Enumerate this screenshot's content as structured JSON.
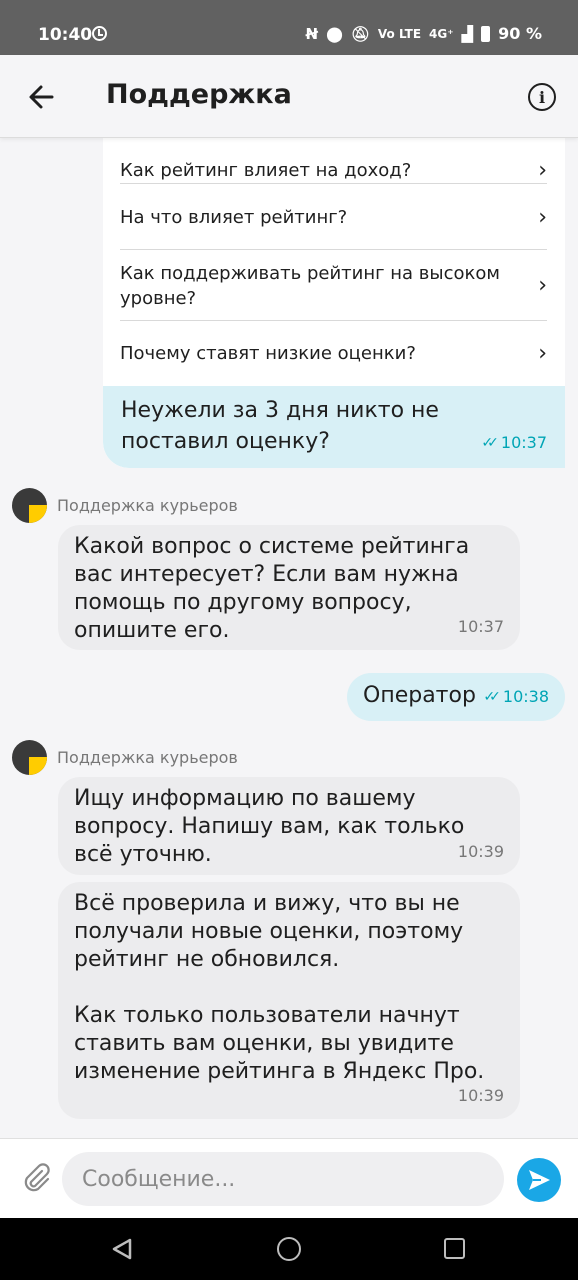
{
  "status_bar": {
    "time": "10:40",
    "network": "4G⁺",
    "volte": "Vo LTE",
    "battery": "90 %",
    "icons": [
      "alarm-clock-icon",
      "nfc-icon",
      "location-icon",
      "mute-icon",
      "volte-icon",
      "signal-icon",
      "battery-icon"
    ]
  },
  "header": {
    "title": "Поддержка",
    "back_icon": "arrow-left-icon",
    "info_icon": "info-icon"
  },
  "faq_card": {
    "items": [
      {
        "label": "Как рейтинг влияет на доход?"
      },
      {
        "label": "На что влияет рейтинг?"
      },
      {
        "label": "Как поддерживать рейтинг на высоком уровне?"
      },
      {
        "label": "Почему ставят низкие оценки?"
      }
    ],
    "chevron_icon": "chevron-right-icon"
  },
  "messages": [
    {
      "type": "out",
      "text": "Неужели за 3 дня никто не поставил оценку?",
      "time": "10:37"
    },
    {
      "type": "in",
      "sender": "Поддержка курьеров",
      "text": "Какой вопрос о системе рейтинга вас интересует? Если вам нужна помощь по другому вопросу, опишите его.",
      "time": "10:37"
    },
    {
      "type": "out",
      "text": "Оператор",
      "time": "10:38"
    },
    {
      "type": "in",
      "sender": "Поддержка курьеров",
      "text": "Ищу информацию по вашему вопросу. Напишу вам, как только всё уточню.",
      "time": "10:39"
    },
    {
      "type": "in",
      "text": "Всё проверила и вижу, что вы не получали новые оценки, поэтому рейтинг не обновился.\n\nКак только пользователи начнут ставить вам оценки, вы увидите изменение рейтинга в Яндекс Про.",
      "time": "10:39"
    }
  ],
  "composer": {
    "placeholder": "Сообщение...",
    "attach_icon": "paperclip-icon",
    "send_icon": "send-icon"
  },
  "colors": {
    "outgoing_bubble": "#d8f0f6",
    "incoming_bubble": "#ececee",
    "accent": "#1aa7e6",
    "read_check": "#00a5b5"
  }
}
